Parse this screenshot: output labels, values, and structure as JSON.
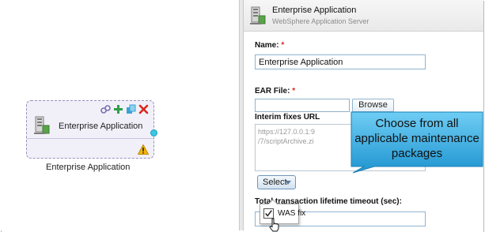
{
  "canvas": {
    "node": {
      "label": "Enterprise Application",
      "caption": "Enterprise Application",
      "toolbar_icons": [
        "link-icon",
        "add-icon",
        "copy-icon",
        "delete-icon"
      ],
      "status_icon": "warning-icon",
      "port_color": "#3cc6e6"
    }
  },
  "panel": {
    "header": {
      "title": "Enterprise Application",
      "subtitle": "WebSphere Application Server"
    },
    "name": {
      "label": "Name:",
      "required": "*",
      "value": "Enterprise Application"
    },
    "ear_file": {
      "label": "EAR File:",
      "required": "*",
      "value": "",
      "browse_label": "Browse"
    },
    "interim_fixes": {
      "label": "Interim fixes URL",
      "line1": "https://127.0.0.1:9",
      "line2": "/7/scriptArchive.zi"
    },
    "select_button": {
      "label": "Select"
    },
    "timeout": {
      "label": "Total transaction lifetime timeout (sec):",
      "value": ""
    },
    "menu": {
      "items": [
        {
          "label": "WAS fix",
          "checked": true
        }
      ]
    }
  },
  "callout": {
    "text": "Choose from all applicable maintenance packages",
    "fill_color": "#2fa8df"
  },
  "colors": {
    "required": "#d9261c",
    "input_border": "#8fb3cf",
    "warning": "#f2b705",
    "delete": "#d9261c"
  }
}
